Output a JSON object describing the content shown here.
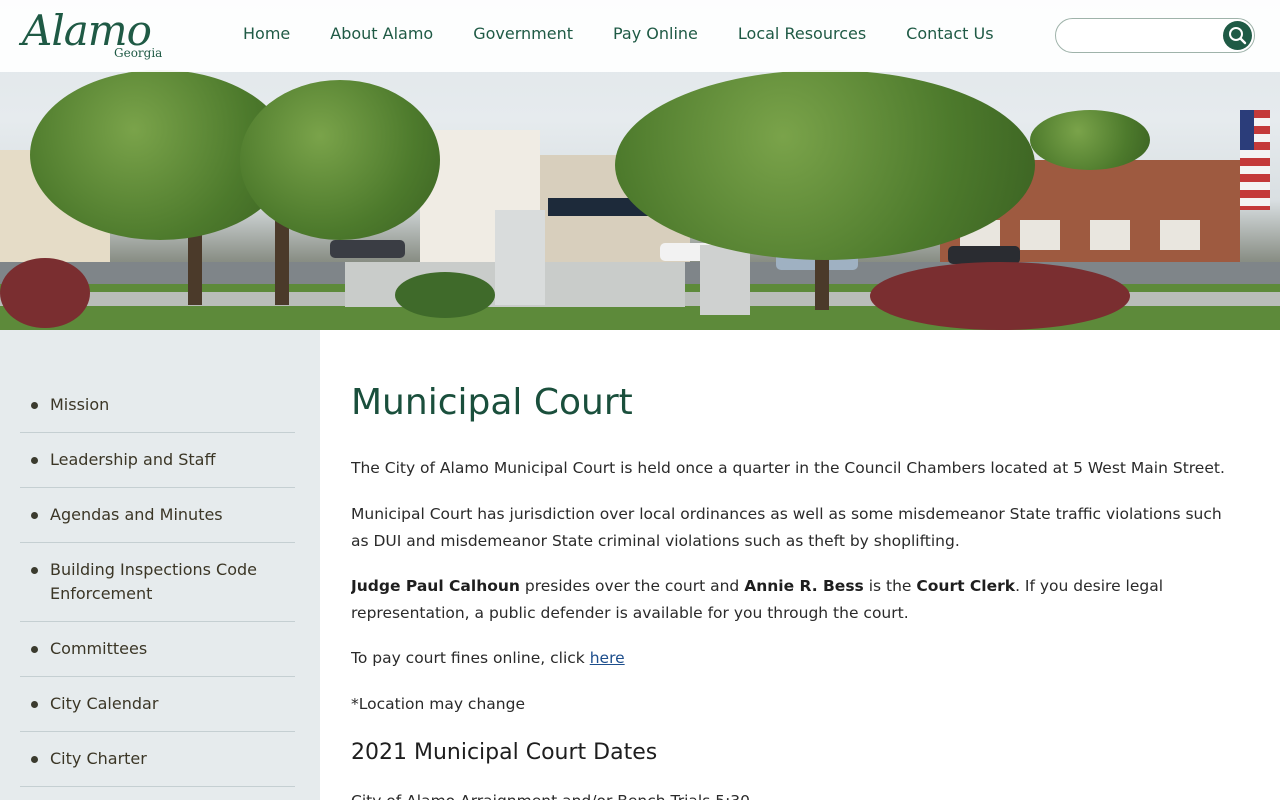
{
  "logo": {
    "main": "Alamo",
    "sub": "Georgia"
  },
  "nav": {
    "items": [
      {
        "label": "Home"
      },
      {
        "label": "About Alamo"
      },
      {
        "label": "Government"
      },
      {
        "label": "Pay Online"
      },
      {
        "label": "Local Resources"
      },
      {
        "label": "Contact Us"
      }
    ]
  },
  "search": {
    "placeholder": "",
    "value": ""
  },
  "sidebar": {
    "items": [
      {
        "label": "Mission"
      },
      {
        "label": "Leadership and Staff"
      },
      {
        "label": "Agendas and Minutes"
      },
      {
        "label": "Building Inspections Code Enforcement"
      },
      {
        "label": "Committees"
      },
      {
        "label": "City Calendar"
      },
      {
        "label": "City Charter"
      }
    ]
  },
  "main": {
    "title": "Municipal Court",
    "p1": "The City of Alamo Municipal Court is held once a quarter in the Council Chambers located at 5 West Main Street.",
    "p2": "Municipal Court has jurisdiction over local ordinances as well as some misdemeanor State traffic violations such as DUI and misdemeanor State criminal violations such as theft by shoplifting.",
    "p3": {
      "judge": "Judge Paul Calhoun",
      "t1": " presides over the court and ",
      "clerk_name": "Annie R. Bess",
      "t2": " is the ",
      "clerk_title": "Court Clerk",
      "t3": ". If you desire legal representation, a public defender is available for you through the court."
    },
    "p4": {
      "text": "To pay court fines online, click ",
      "link": "here"
    },
    "p5": "*Location may change",
    "subheading": "2021 Municipal Court Dates",
    "cutoff_line": "City of Alamo Arraignment and/or Bench Trials 5:30"
  }
}
